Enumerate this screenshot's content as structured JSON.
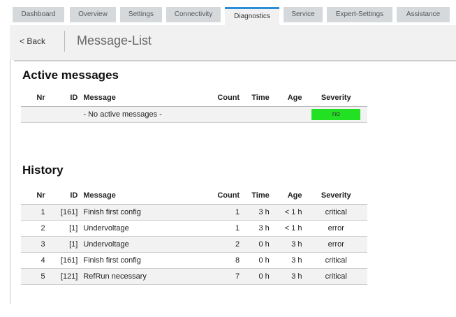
{
  "tabs": [
    {
      "label": "Dashboard"
    },
    {
      "label": "Overview"
    },
    {
      "label": "Settings"
    },
    {
      "label": "Connectivity"
    },
    {
      "label": "Diagnostics",
      "active": true
    },
    {
      "label": "Service"
    },
    {
      "label": "Expert-Settings"
    },
    {
      "label": "Assistance"
    }
  ],
  "header": {
    "back_label": "< Back",
    "title": "Message-List"
  },
  "active": {
    "title": "Active messages",
    "columns": {
      "nr": "Nr",
      "id": "ID",
      "message": "Message",
      "count": "Count",
      "time": "Time",
      "age": "Age",
      "severity": "Severity"
    },
    "empty_message": "- No active messages -",
    "status": {
      "label": "no",
      "color": "#22e022"
    }
  },
  "history": {
    "title": "History",
    "columns": {
      "nr": "Nr",
      "id": "ID",
      "message": "Message",
      "count": "Count",
      "time": "Time",
      "age": "Age",
      "severity": "Severity"
    },
    "rows": [
      {
        "nr": "1",
        "id": "[161]",
        "message": "Finish first config",
        "count": "1",
        "time": "3 h",
        "age": "< 1 h",
        "severity": "critical"
      },
      {
        "nr": "2",
        "id": "[1]",
        "message": "Undervoltage",
        "count": "1",
        "time": "3 h",
        "age": "< 1 h",
        "severity": "error"
      },
      {
        "nr": "3",
        "id": "[1]",
        "message": "Undervoltage",
        "count": "2",
        "time": "0 h",
        "age": "3 h",
        "severity": "error"
      },
      {
        "nr": "4",
        "id": "[161]",
        "message": "Finish first config",
        "count": "8",
        "time": "0 h",
        "age": "3 h",
        "severity": "critical"
      },
      {
        "nr": "5",
        "id": "[121]",
        "message": "RefRun necessary",
        "count": "7",
        "time": "0 h",
        "age": "3 h",
        "severity": "critical"
      }
    ]
  }
}
